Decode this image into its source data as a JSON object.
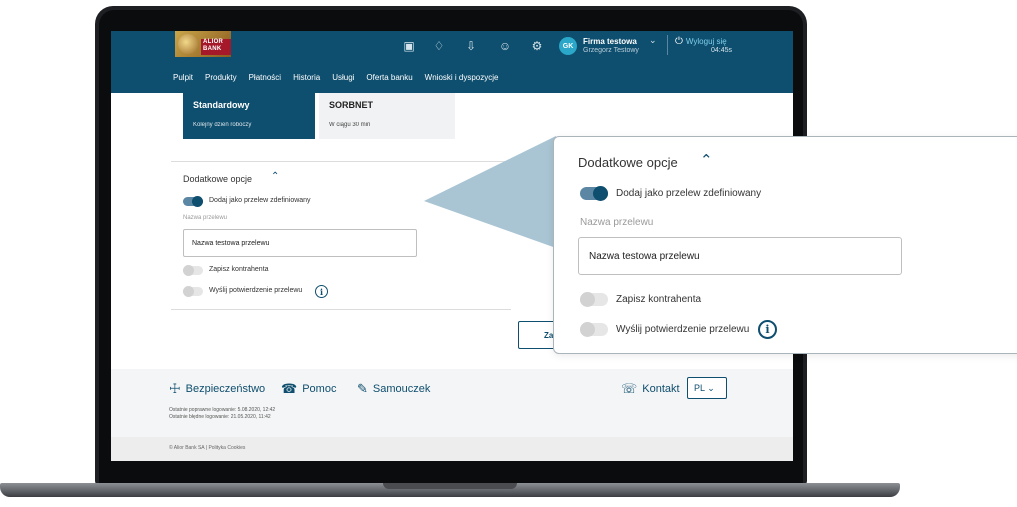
{
  "brand": {
    "logo_text": "ALIOR BANK",
    "primary_color": "#0e4e6e",
    "accent_color": "#2aa7c9"
  },
  "header": {
    "user_initials": "GK",
    "company": "Firma testowa",
    "user_name": "Grzegorz Testowy",
    "logout_label": "Wyloguj się",
    "session_timer": "04:45s",
    "icons": [
      "briefcase-icon",
      "bell-icon",
      "download-icon",
      "user-icon",
      "settings-icon"
    ]
  },
  "nav": [
    "Pulpit",
    "Produkty",
    "Płatności",
    "Historia",
    "Usługi",
    "Oferta banku",
    "Wnioski i dyspozycje"
  ],
  "transfer_types": [
    {
      "title": "Standardowy",
      "subtitle": "Kolejny dzień roboczy",
      "selected": true
    },
    {
      "title": "SORBNET",
      "subtitle": "W ciągu 30 min",
      "selected": false
    }
  ],
  "options": {
    "title": "Dodatkowe opcje",
    "define_toggle_label": "Dodaj jako przelew zdefiniowany",
    "define_toggle_on": true,
    "name_label": "Nazwa przelewu",
    "name_value": "Nazwa testowa przelewu",
    "save_contractor_label": "Zapisz kontrahenta",
    "save_contractor_on": false,
    "send_confirmation_label": "Wyślij potwierdzenie przelewu",
    "send_confirmation_on": false
  },
  "action_button_partial": "Za",
  "footer": {
    "security": "Bezpieczeństwo",
    "help": "Pomoc",
    "tutorial": "Samouczek",
    "contact": "Kontakt",
    "language": "PL",
    "last_login_ok": "Ostatnie poprawne logowanie: 5.08.2020, 12:42",
    "last_login_fail": "Ostatnie błędne logowanie: 21.05.2020, 11:42",
    "copyright": "© Alior Bank SA | Polityka Cookies"
  }
}
